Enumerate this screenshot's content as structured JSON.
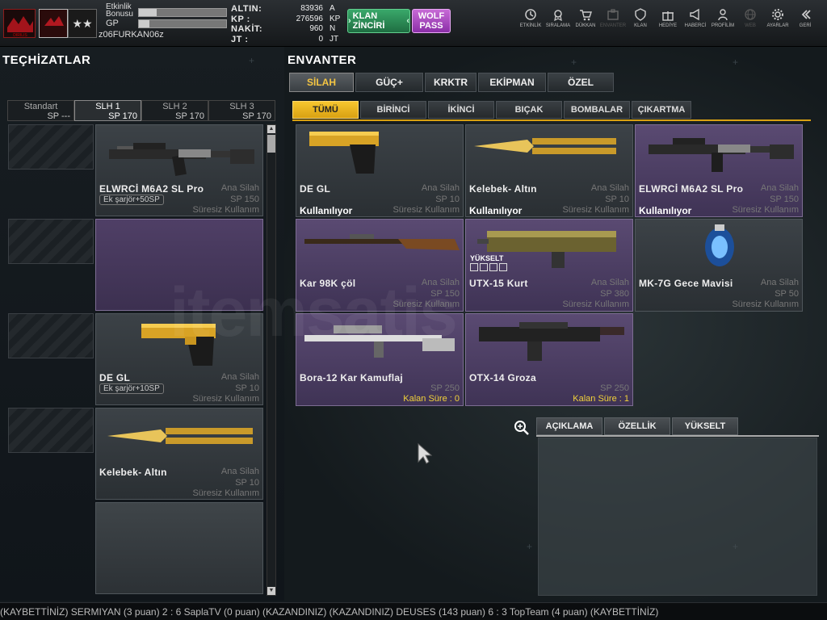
{
  "topbar": {
    "player": {
      "event_bonus_label": "Etkinlik Bonusu",
      "gp_label": "GP",
      "username": "z06FURKAN06z"
    },
    "currencies": [
      {
        "label": "ALTIN:",
        "value": "83936",
        "unit": "A"
      },
      {
        "label": "KP :",
        "value": "276596",
        "unit": "KP"
      },
      {
        "label": "NAKİT:",
        "value": "960",
        "unit": "N"
      },
      {
        "label": "JT :",
        "value": "0",
        "unit": "JT"
      }
    ],
    "klan_button": "KLAN ZİNCİRİ",
    "wolf_button": [
      "WOLF",
      "PASS"
    ],
    "menu": [
      {
        "icon": "clock-icon",
        "label": "ETKİNLİK"
      },
      {
        "icon": "rank-icon",
        "label": "SIRALAMA"
      },
      {
        "icon": "cart-icon",
        "label": "DÜKKAN"
      },
      {
        "icon": "inventory-icon",
        "label": "ENVANTER"
      },
      {
        "icon": "shield-icon",
        "label": "KLAN"
      },
      {
        "icon": "gift-icon",
        "label": "HEDİYE"
      },
      {
        "icon": "megaphone-icon",
        "label": "HABERCİ"
      },
      {
        "icon": "profile-icon",
        "label": "PROFİLİM"
      },
      {
        "icon": "globe-icon",
        "label": "WEB"
      },
      {
        "icon": "gear-icon",
        "label": "AYARLAR"
      },
      {
        "icon": "back-icon",
        "label": "GERİ"
      }
    ]
  },
  "left_panel": {
    "title": "TEÇHİZATLAR",
    "slots": [
      {
        "name": "Standart",
        "sp": "SP ---"
      },
      {
        "name": "SLH 1",
        "sp": "SP 170"
      },
      {
        "name": "SLH 2",
        "sp": "SP 170"
      },
      {
        "name": "SLH 3",
        "sp": "SP 170"
      }
    ],
    "equipped": [
      {
        "name": "ELWRCİ M6A2 SL Pro",
        "type": "Ana Silah",
        "sp": "SP 150",
        "duration": "Süresiz Kullanım",
        "extra": "Ek şarjör+50SP"
      },
      {
        "name": "",
        "type": "",
        "sp": "",
        "duration": "",
        "extra": ""
      },
      {
        "name": "DE GL",
        "type": "Ana Silah",
        "sp": "SP 10",
        "duration": "Süresiz Kullanım",
        "extra": "Ek şarjör+10SP"
      },
      {
        "name": "Kelebek- Altın",
        "type": "Ana Silah",
        "sp": "SP 10",
        "duration": "Süresiz Kullanım",
        "extra": ""
      }
    ]
  },
  "right_panel": {
    "title": "ENVANTER",
    "main_tabs": [
      "SİLAH",
      "GÜÇ+",
      "KRKTR",
      "EKİPMAN",
      "ÖZEL"
    ],
    "sub_tabs": [
      "TÜMÜ",
      "BİRİNCİ",
      "İKİNCİ",
      "BIÇAK",
      "BOMBALAR",
      "ÇIKARTMA"
    ],
    "items": [
      {
        "name": "DE GL",
        "type": "Ana Silah",
        "sp": "SP 10",
        "duration": "Süresiz Kullanım",
        "using": "Kullanılıyor"
      },
      {
        "name": "Kelebek- Altın",
        "type": "Ana Silah",
        "sp": "SP 10",
        "duration": "Süresiz Kullanım",
        "using": "Kullanılıyor"
      },
      {
        "name": "ELWRCİ M6A2 SL Pro",
        "type": "Ana Silah",
        "sp": "SP 150",
        "duration": "Süresiz Kullanım",
        "using": "Kullanılıyor"
      },
      {
        "name": "Kar 98K çöl",
        "type": "Ana Silah",
        "sp": "SP 150",
        "duration": "Süresiz Kullanım",
        "using": ""
      },
      {
        "name": "UTX-15 Kurt",
        "type": "Ana Silah",
        "sp": "SP 380",
        "duration": "Süresiz Kullanım",
        "using": "",
        "badge": "YÜKSELT"
      },
      {
        "name": "MK-7G Gece Mavisi",
        "type": "Ana Silah",
        "sp": "SP 50",
        "duration": "Süresiz Kullanım",
        "using": ""
      },
      {
        "name": "Bora-12 Kar Kamuflaj",
        "type": "",
        "sp": "SP 250",
        "duration": "Kalan Süre : 0",
        "using": ""
      },
      {
        "name": "OTX-14 Groza",
        "type": "",
        "sp": "SP 250",
        "duration": "Kalan Süre : 1",
        "using": ""
      }
    ],
    "info_tabs": [
      "AÇIKLAMA",
      "ÖZELLİK",
      "YÜKSELT"
    ]
  },
  "ticker": "(KAYBETTİNİZ) SERMIYAN (3 puan) 2 : 6 SaplaTV (0 puan) (KAZANDINIZ)          (KAZANDINIZ) DEUSES (143 puan) 6 : 3 TopTeam (4 puan) (KAYBETTİNİZ)",
  "watermark": "itemsatis",
  "colors": {
    "accent": "#f4c542",
    "purple_card": "#5a4a72",
    "klan": "#2f8f57",
    "wolf": "#b458c8"
  }
}
